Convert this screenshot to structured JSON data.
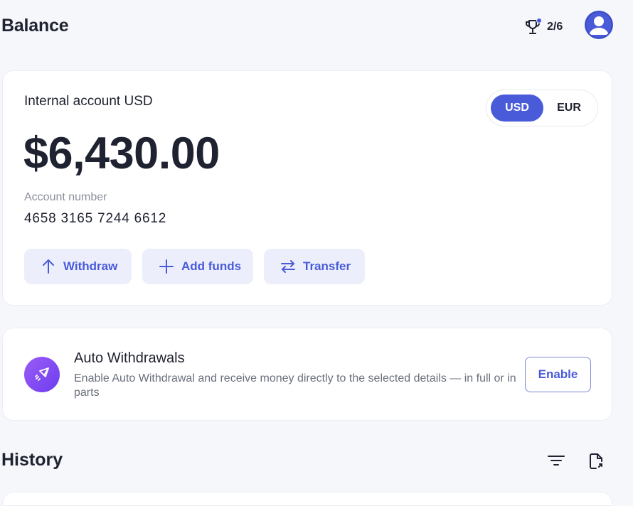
{
  "header": {
    "title": "Balance",
    "progress": "2/6",
    "icons": {
      "trophy": "trophy-icon",
      "avatar": "user-avatar-icon"
    }
  },
  "balance": {
    "account_title": "Internal account USD",
    "amount": "$6,430.00",
    "account_number_label": "Account number",
    "account_number": "4658 3165 7244 6612",
    "currency_options": [
      "USD",
      "EUR"
    ],
    "selected_currency": "USD",
    "actions": {
      "withdraw": "Withdraw",
      "add_funds": "Add funds",
      "transfer": "Transfer"
    }
  },
  "auto_withdrawals": {
    "title": "Auto Withdrawals",
    "description": "Enable Auto Withdrawal and receive money directly to the selected details — in full or in parts",
    "button": "Enable"
  },
  "history": {
    "title": "History",
    "icons": {
      "filter": "filter-icon",
      "export": "export-file-icon"
    }
  },
  "colors": {
    "accent": "#4a5bd9",
    "accent_soft": "#eceffb",
    "background": "#f6f7fb",
    "text": "#1f2230",
    "muted": "#8a8f9c",
    "badge_gradient_start": "#9b5cf6",
    "badge_gradient_end": "#6d3df0"
  }
}
